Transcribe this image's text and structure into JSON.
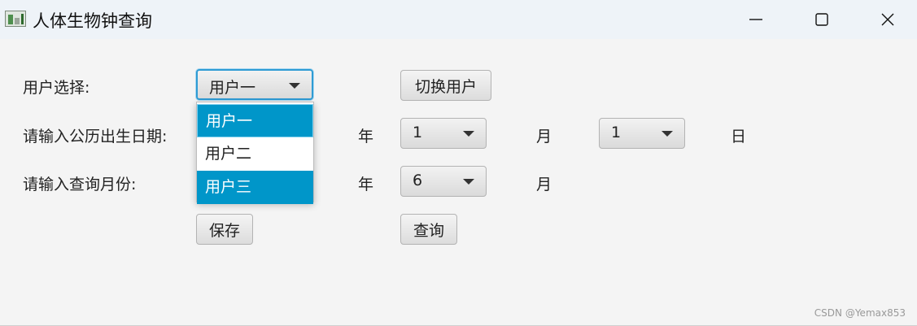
{
  "window": {
    "title": "人体生物钟查询",
    "controls": [
      "minimize-icon",
      "maximize-icon",
      "close-icon"
    ]
  },
  "form": {
    "user_label": "用户选择:",
    "user_select_value": "用户一",
    "switch_user_button": "切换用户",
    "birth_label": "请输入公历出生日期:",
    "birth_year_unit": "年",
    "birth_month_value": "1",
    "birth_month_unit": "月",
    "birth_day_value": "1",
    "birth_day_unit": "日",
    "query_label": "请输入查询月份:",
    "query_year_unit": "年",
    "query_month_value": "6",
    "query_month_unit": "月",
    "save_button": "保存",
    "query_button": "查询"
  },
  "user_dropdown": {
    "options": [
      "用户一",
      "用户二",
      "用户三"
    ],
    "selected_index": 0
  },
  "colors": {
    "selection": "#0096c9",
    "focus_ring": "#2e9bd4",
    "titlebar": "#eef3f8",
    "background": "#f4f4f4"
  },
  "watermark": "CSDN @Yemax853"
}
